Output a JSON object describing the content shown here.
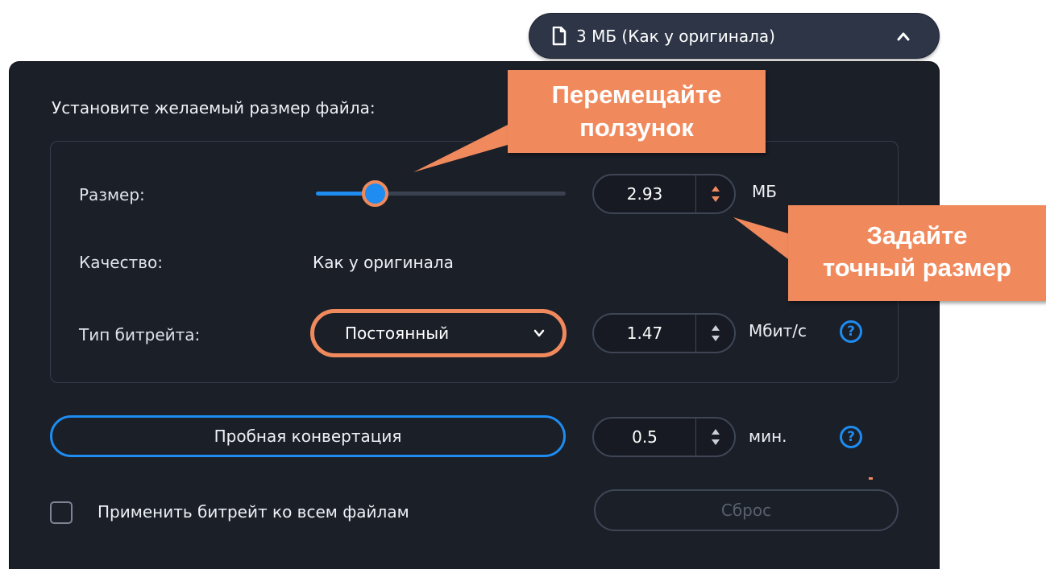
{
  "size_dropdown": {
    "label": "3 МБ (Как у оригинала)",
    "icon": "file-icon",
    "chevron": "chevron-up-icon"
  },
  "panel": {
    "title": "Установите желаемый размер файла:",
    "size_row": {
      "label": "Размер:",
      "value": "2.93",
      "unit": "МБ",
      "slider_position": 0.24
    },
    "quality_row": {
      "label": "Качество:",
      "value": "Как у оригинала"
    },
    "bitrate_row": {
      "label": "Тип битрейта:",
      "type_selected": "Постоянный",
      "value": "1.47",
      "unit": "Мбит/с",
      "help": "?"
    },
    "trial": {
      "button_label": "Пробная конвертация",
      "value": "0.5",
      "unit": "мин.",
      "help": "?"
    },
    "apply_all": {
      "label": "Применить битрейт ко всем файлам",
      "checked": false
    },
    "reset_label": "Сброс"
  },
  "callouts": {
    "slider_hint": "Перемещайте\nползунок",
    "size_hint": "Задайте\nточный размер"
  },
  "colors": {
    "accent": "#1e8cf0",
    "highlight": "#f08a5d",
    "panel_bg": "#1b1f28",
    "pill_bg": "#2d3547"
  }
}
